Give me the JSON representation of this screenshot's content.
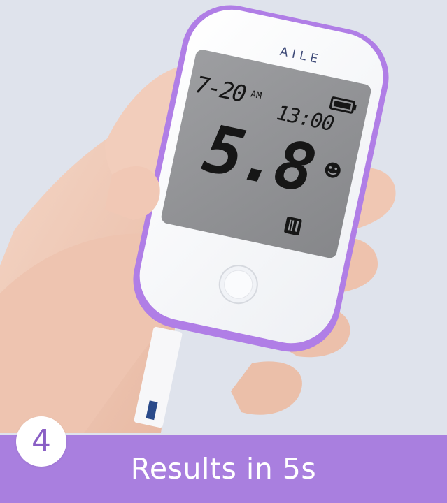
{
  "product": {
    "brand": "AILE"
  },
  "meter_display": {
    "date": "7-20",
    "am_pm": "AM",
    "time": "13:00",
    "reading": "5.8",
    "icons": [
      "battery-icon",
      "smiley-icon",
      "fork-knife-icon"
    ]
  },
  "caption": {
    "step_number": "4",
    "text": "Results in 5s"
  },
  "colors": {
    "accent_purple": "#a97fdf",
    "meter_trim": "#b07ee6",
    "lcd_gray": "#8f9093",
    "background": "#dfe3ec"
  }
}
